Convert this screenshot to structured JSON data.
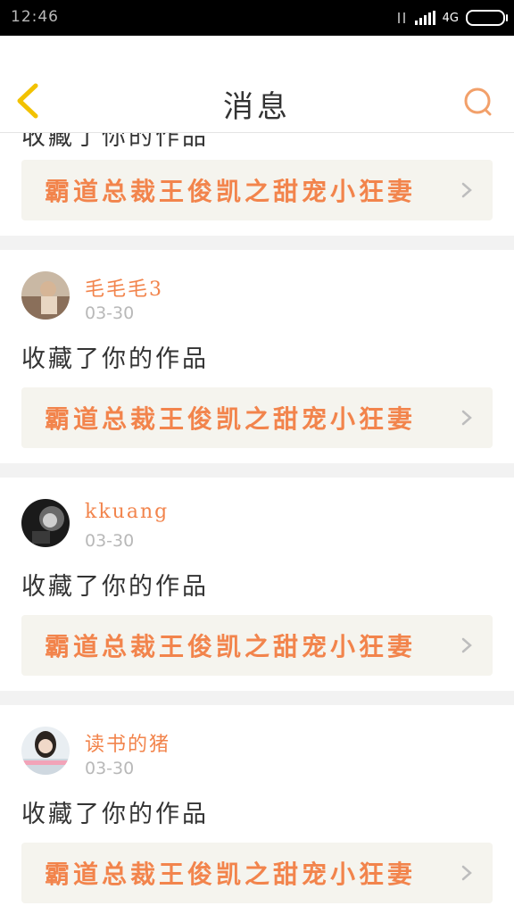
{
  "status_bar": {
    "time": "12:46",
    "network": "4G"
  },
  "header": {
    "title": "消息"
  },
  "messages": [
    {
      "action": "收藏了你的作品",
      "work_title": "霸道总裁王俊凯之甜宠小狂妻"
    },
    {
      "user": "毛毛毛3",
      "date": "03-30",
      "action": "收藏了你的作品",
      "work_title": "霸道总裁王俊凯之甜宠小狂妻"
    },
    {
      "user": "kkuang",
      "date": "03-30",
      "action": "收藏了你的作品",
      "work_title": "霸道总裁王俊凯之甜宠小狂妻"
    },
    {
      "user": "读书的猪",
      "date": "03-30",
      "action": "收藏了你的作品",
      "work_title": "霸道总裁王俊凯之甜宠小狂妻"
    }
  ],
  "colors": {
    "accent": "#f2844c",
    "link_bg": "#f5f4ee",
    "back_icon": "#f2c200"
  }
}
